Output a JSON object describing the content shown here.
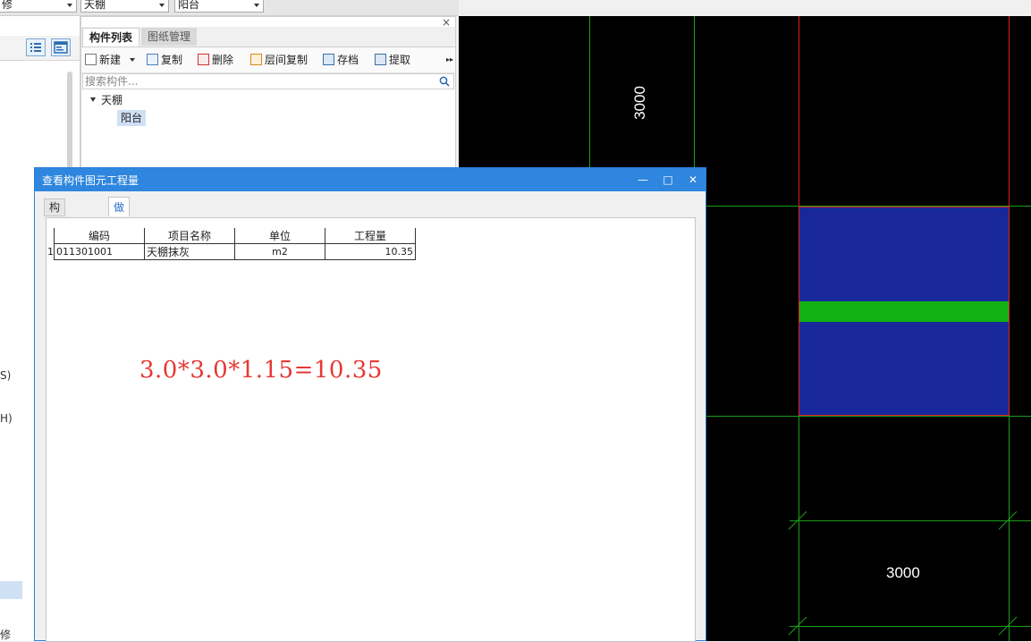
{
  "top_combos": [
    {
      "value": "修"
    },
    {
      "value": "天棚"
    },
    {
      "value": "阳台"
    }
  ],
  "left_panel": {
    "fragments": [
      "S)",
      "H)",
      "修"
    ]
  },
  "component_list": {
    "close_glyph": "×",
    "tabs": [
      {
        "label": "构件列表"
      },
      {
        "label": "图纸管理"
      }
    ],
    "toolbar": {
      "new": "新建",
      "copy": "复制",
      "delete": "删除",
      "floor_copy": "层间复制",
      "save": "存档",
      "extract": "提取",
      "more": "▸▸"
    },
    "search_placeholder": "搜索构件...",
    "tree": {
      "category": "天棚",
      "item": "阳台"
    }
  },
  "dialog": {
    "title": "查看构件图元工程量",
    "window_buttons": {
      "minimize": "—",
      "maximize": "□",
      "close": "✕"
    },
    "tabs": [
      {
        "label": "构件工程量",
        "active": false
      },
      {
        "label": "做法工程量",
        "active": true
      }
    ],
    "table": {
      "headers": [
        "编码",
        "项目名称",
        "单位",
        "工程量"
      ],
      "rows": [
        {
          "num": "1",
          "code": "011301001",
          "name": "天棚抹灰",
          "unit": "m2",
          "qty": "10.35"
        }
      ]
    },
    "annotation": "3.0*3.0*1.15=10.35"
  },
  "cad": {
    "dim_vertical": "3000",
    "dim_horizontal": "3000",
    "colors": {
      "background": "#000000",
      "grid": "#1aa01a",
      "border": "#e02020",
      "slab": "#18289a",
      "band": "#12b012"
    }
  }
}
